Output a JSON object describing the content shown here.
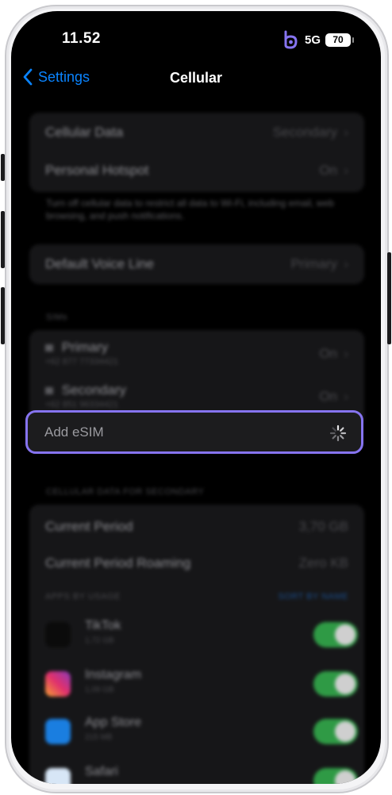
{
  "status_bar": {
    "time": "11.52",
    "network": "5G",
    "battery": "70",
    "brand_icon": "b-shaped-app-icon"
  },
  "nav": {
    "back_label": "Settings",
    "title": "Cellular"
  },
  "group1": {
    "rows": [
      {
        "label": "Cellular Data",
        "value": "Secondary"
      },
      {
        "label": "Personal Hotspot",
        "value": "On"
      }
    ],
    "footnote": "Turn off cellular data to restrict all data to Wi-Fi, including email, web browsing, and push notifications."
  },
  "group2": {
    "rows": [
      {
        "label": "Default Voice Line",
        "value": "Primary"
      }
    ]
  },
  "sims": {
    "header": "SIMs",
    "items": [
      {
        "label": "Primary",
        "number": "+62 877 77334421",
        "value": "On"
      },
      {
        "label": "Secondary",
        "number": "+62 851 96334421",
        "value": "On"
      }
    ],
    "add_esim_label": "Add eSIM"
  },
  "data_usage": {
    "header": "CELLULAR DATA FOR SECONDARY",
    "rows": [
      {
        "label": "Current Period",
        "value": "3,70 GB"
      },
      {
        "label": "Current Period Roaming",
        "value": "Zero KB"
      }
    ],
    "apps_header": "APPS BY USAGE",
    "sort_label": "SORT BY NAME",
    "apps": [
      {
        "name": "TikTok",
        "size": "1,72 GB",
        "enabled": true
      },
      {
        "name": "Instagram",
        "size": "1,09 GB",
        "enabled": true
      },
      {
        "name": "App Store",
        "size": "215 MB",
        "enabled": true
      },
      {
        "name": "Safari",
        "size": "",
        "enabled": true
      }
    ]
  },
  "colors": {
    "accent_blue": "#0a84ff",
    "highlight_purple": "#8674f0",
    "toggle_green": "#2f9a45"
  }
}
